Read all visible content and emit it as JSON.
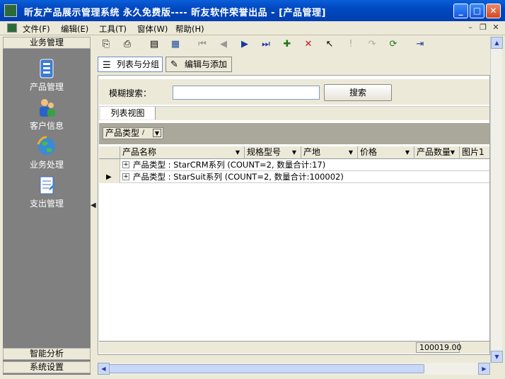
{
  "window": {
    "title": "昕友产品展示管理系统 永久免费版---- 昕友软件荣誉出品  - [产品管理]"
  },
  "menu": {
    "file": "文件(F)",
    "edit": "编辑(E)",
    "tools": "工具(T)",
    "window": "窗体(W)",
    "help": "帮助(H)"
  },
  "left_panel": {
    "header": "业务管理",
    "items": [
      {
        "label": "产品管理",
        "icon": "product-icon"
      },
      {
        "label": "客户信息",
        "icon": "customer-icon"
      },
      {
        "label": "业务处理",
        "icon": "business-globe-icon"
      },
      {
        "label": "支出管理",
        "icon": "expense-icon"
      }
    ],
    "footer1": "智能分析",
    "footer2": "系统设置"
  },
  "tabs": {
    "list": "列表与分组",
    "edit": "编辑与添加"
  },
  "search": {
    "label": "模糊搜索：",
    "value": "",
    "button": "搜索"
  },
  "list_view_tab": "列表视图",
  "group_chip": "产品类型",
  "columns": [
    "产品名称",
    "规格型号",
    "产地",
    "价格",
    "产品数量",
    "图片1"
  ],
  "groups": [
    {
      "text": "产品类型 : StarCRM系列 (COUNT=2, 数量合计:17)"
    },
    {
      "text": "产品类型 : StarSuit系列 (COUNT=2, 数量合计:100002)"
    }
  ],
  "footer_total": "100019.00",
  "colors": {
    "titlebar": "#0048c0",
    "panel": "#808080",
    "face": "#ece9d8"
  }
}
